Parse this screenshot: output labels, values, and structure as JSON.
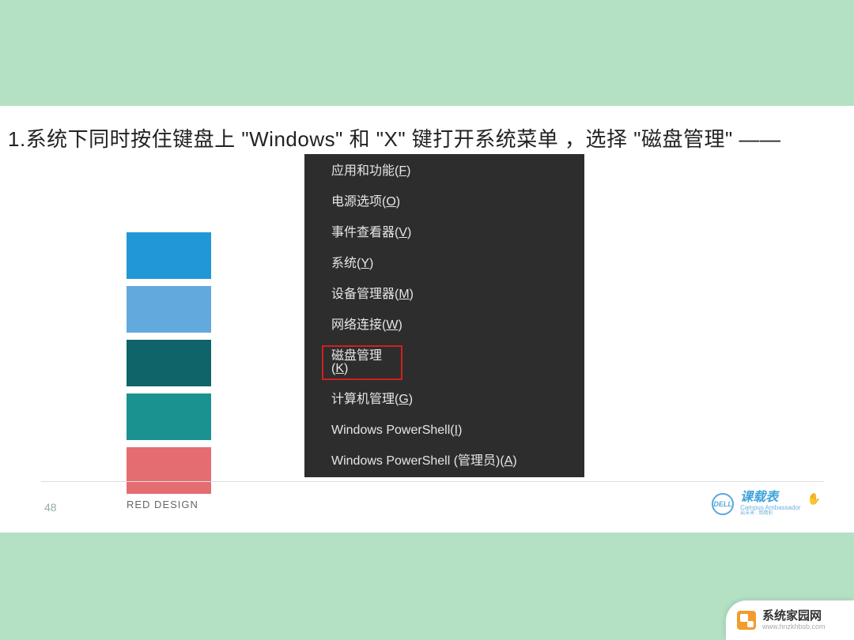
{
  "instruction": "1.系统下同时按住键盘上 \"Windows\" 和 \"X\" 键打开系统菜单 ，选择 \"磁盘管理\"  ——",
  "swatches": [
    "#2297d7",
    "#62a9dd",
    "#0e6469",
    "#1a9290",
    "#e36d71"
  ],
  "page_number": "48",
  "footer_label": "RED DESIGN",
  "winmenu": {
    "items": [
      {
        "label": "应用和功能(",
        "hotkey": "F",
        "tail": ")",
        "highlighted": false
      },
      {
        "label": "电源选项(",
        "hotkey": "O",
        "tail": ")",
        "highlighted": false
      },
      {
        "label": "事件查看器(",
        "hotkey": "V",
        "tail": ")",
        "highlighted": false
      },
      {
        "label": "系统(",
        "hotkey": "Y",
        "tail": ")",
        "highlighted": false
      },
      {
        "label": "设备管理器(",
        "hotkey": "M",
        "tail": ")",
        "highlighted": false
      },
      {
        "label": "网络连接(",
        "hotkey": "W",
        "tail": ")",
        "highlighted": false
      },
      {
        "label": "磁盘管理(",
        "hotkey": "K",
        "tail": ")",
        "highlighted": true
      },
      {
        "label": "计算机管理(",
        "hotkey": "G",
        "tail": ")",
        "highlighted": false
      },
      {
        "label": "Windows PowerShell(",
        "hotkey": "I",
        "tail": ")",
        "highlighted": false
      },
      {
        "label": "Windows PowerShell (管理员)(",
        "hotkey": "A",
        "tail": ")",
        "highlighted": false
      }
    ]
  },
  "dell": {
    "logo_text": "DELL",
    "cn": "课载表",
    "en": "Campus Ambassador",
    "sub": "启未来 · 筑精彩"
  },
  "watermark": {
    "name": "系统家园网",
    "url": "www.hnzkhbsb.com"
  }
}
